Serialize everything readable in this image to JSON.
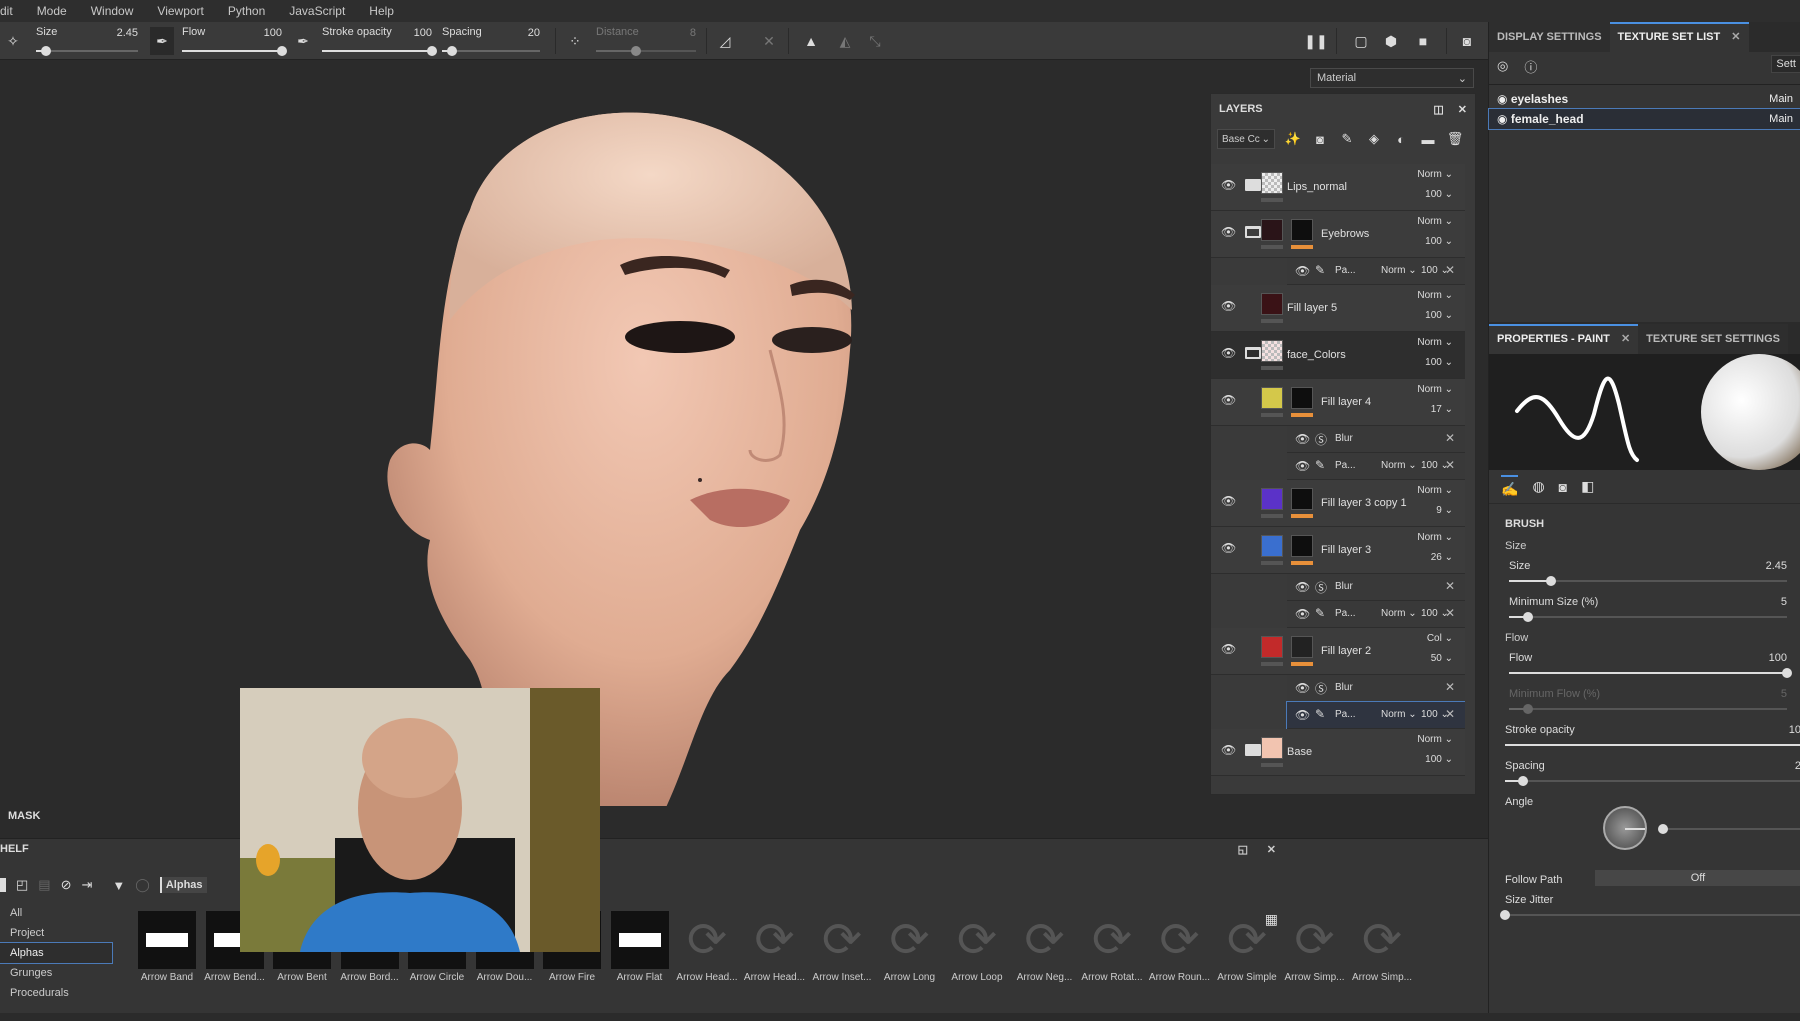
{
  "menubar": {
    "items": [
      "dit",
      "Mode",
      "Window",
      "Viewport",
      "Python",
      "JavaScript",
      "Help"
    ]
  },
  "toolbar": {
    "size": {
      "label": "Size",
      "value": "2.45",
      "fraction": 0.1
    },
    "flow": {
      "label": "Flow",
      "value": "100",
      "fraction": 1.0
    },
    "stroke_opacity": {
      "label": "Stroke opacity",
      "value": "100",
      "fraction": 1.0
    },
    "spacing": {
      "label": "Spacing",
      "value": "20",
      "fraction": 0.1
    },
    "distance": {
      "label": "Distance",
      "value": "8",
      "fraction": 0.4
    }
  },
  "viewport": {
    "material_mode": "Material"
  },
  "layers": {
    "title": "LAYERS",
    "channel": "Base Cc",
    "rows": [
      {
        "type": "main",
        "name": "Lips_normal",
        "blend": "Norm",
        "opacity": "100",
        "folder": "closed",
        "thumb": "checker",
        "mask": null
      },
      {
        "type": "main",
        "name": "Eyebrows",
        "blend": "Norm",
        "opacity": "100",
        "folder": "open",
        "thumb": "#2a1418",
        "mask": "#0e0e0e"
      },
      {
        "type": "sub",
        "kind": "paint",
        "name": "Pa...",
        "blend": "Norm",
        "opacity": "100"
      },
      {
        "type": "main",
        "name": "Fill layer 5",
        "blend": "Norm",
        "opacity": "100",
        "folder": null,
        "thumb": "#3a1216",
        "mask": null
      },
      {
        "type": "main",
        "name": "face_Colors",
        "blend": "Norm",
        "opacity": "100",
        "folder": "open",
        "thumb": "checker-red",
        "mask": null,
        "dark": true
      },
      {
        "type": "main",
        "name": "Fill layer 4",
        "blend": "Norm",
        "opacity": "17",
        "folder": null,
        "thumb": "#d4c84a",
        "mask": "#0e0e0e"
      },
      {
        "type": "sub",
        "kind": "blur",
        "name": "Blur"
      },
      {
        "type": "sub",
        "kind": "paint",
        "name": "Pa...",
        "blend": "Norm",
        "opacity": "100"
      },
      {
        "type": "main",
        "name": "Fill layer 3 copy 1",
        "blend": "Norm",
        "opacity": "9",
        "folder": null,
        "thumb": "#5b32c8",
        "mask": "#0e0e0e"
      },
      {
        "type": "main",
        "name": "Fill layer 3",
        "blend": "Norm",
        "opacity": "26",
        "folder": null,
        "thumb": "#3a6fcf",
        "mask": "#0e0e0e"
      },
      {
        "type": "sub",
        "kind": "blur",
        "name": "Blur"
      },
      {
        "type": "sub",
        "kind": "paint",
        "name": "Pa...",
        "blend": "Norm",
        "opacity": "100"
      },
      {
        "type": "main",
        "name": "Fill layer 2",
        "blend": "Col",
        "opacity": "50",
        "folder": null,
        "thumb": "#c22a2a",
        "mask": "#222"
      },
      {
        "type": "sub",
        "kind": "blur",
        "name": "Blur"
      },
      {
        "type": "sub",
        "kind": "paint",
        "name": "Pa...",
        "blend": "Norm",
        "opacity": "100",
        "selected": true
      },
      {
        "type": "main",
        "name": "Base",
        "blend": "Norm",
        "opacity": "100",
        "folder": "closed",
        "thumb": "#f2c4b0",
        "mask": null
      }
    ]
  },
  "texture_set_list": {
    "tabs": [
      "DISPLAY SETTINGS",
      "TEXTURE SET LIST"
    ],
    "settings_button": "Sett",
    "items": [
      {
        "name": "eyelashes",
        "shader": "Main"
      },
      {
        "name": "female_head",
        "shader": "Main",
        "selected": true
      }
    ]
  },
  "properties": {
    "tabs": [
      "PROPERTIES - PAINT",
      "TEXTURE SET SETTINGS"
    ],
    "section": "BRUSH",
    "size_group": "Size",
    "size": {
      "label": "Size",
      "value": "2.45",
      "fraction": 0.15
    },
    "min_size": {
      "label": "Minimum Size (%)",
      "value": "5",
      "fraction": 0.07
    },
    "flow_group": "Flow",
    "flow": {
      "label": "Flow",
      "value": "100",
      "fraction": 1.0
    },
    "min_flow": {
      "label": "Minimum Flow (%)",
      "value": "5",
      "fraction": 0.07
    },
    "stroke_opacity": {
      "label": "Stroke opacity",
      "value": "10",
      "fraction": 1.0
    },
    "spacing": {
      "label": "Spacing",
      "value": "2",
      "fraction": 0.06
    },
    "angle_label": "Angle",
    "follow_path": {
      "label": "Follow Path",
      "value": "Off"
    },
    "size_jitter": {
      "label": "Size Jitter",
      "fraction": 0.0
    }
  },
  "mask_label": "MASK",
  "shelf": {
    "title": "HELF",
    "filter": "Alphas",
    "categories": [
      "All",
      "Project",
      "Alphas",
      "Grunges",
      "Procedurals"
    ],
    "selected_category": "Alphas",
    "assets": [
      "Arrow Band",
      "Arrow Bend...",
      "Arrow Bent",
      "Arrow Bord...",
      "Arrow Circle",
      "Arrow Dou...",
      "Arrow Fire",
      "Arrow Flat",
      "Arrow Head...",
      "Arrow Head...",
      "Arrow Inset...",
      "Arrow Long",
      "Arrow Loop",
      "Arrow Neg...",
      "Arrow Rotat...",
      "Arrow Roun...",
      "Arrow Simple",
      "Arrow Simp...",
      "Arrow Simp..."
    ]
  }
}
